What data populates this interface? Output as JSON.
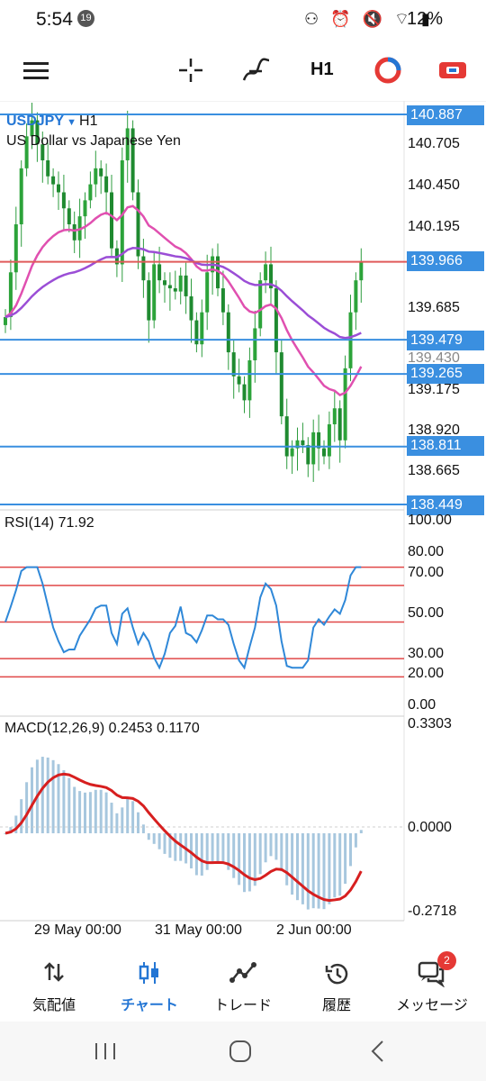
{
  "status_bar": {
    "time": "5:54",
    "notification_count": "19",
    "icons": "⚇ ⏰ 🔇 ⌔ ▮",
    "battery": "12%"
  },
  "toolbar": {
    "timeframe": "H1"
  },
  "chart": {
    "symbol": "USDJPY",
    "timeframe": "H1",
    "description": "US Dollar vs Japanese Yen",
    "price_axis": [
      "140.705",
      "140.450",
      "140.195",
      "139.685",
      "139.175",
      "138.920",
      "138.665"
    ],
    "hidden_axis": [
      "139.430"
    ],
    "hlines": [
      "140.887",
      "139.966",
      "139.479",
      "139.265",
      "138.811",
      "138.449"
    ],
    "rsi": {
      "title": "RSI(14) 71.92",
      "levels": [
        "100.00",
        "80.00",
        "70.00",
        "50.00",
        "30.00",
        "20.00",
        "0.00"
      ]
    },
    "macd": {
      "title": "MACD(12,26,9) 0.2453 0.1170",
      "levels": [
        "0.3303",
        "0.0000",
        "-0.2718"
      ]
    },
    "time_axis": [
      "29 May 00:00",
      "31 May 00:00",
      "2 Jun 00:00"
    ]
  },
  "bottom_nav": [
    {
      "label": "気配値",
      "icon": "sort-arrows-icon"
    },
    {
      "label": "チャート",
      "icon": "candles-icon"
    },
    {
      "label": "トレード",
      "icon": "trend-icon"
    },
    {
      "label": "履歴",
      "icon": "history-icon"
    },
    {
      "label": "メッセージ",
      "icon": "chat-icon",
      "badge": "2"
    }
  ],
  "chart_data": {
    "type": "candlestick",
    "symbol": "USDJPY",
    "timeframe": "H1",
    "x_labels": [
      "29 May 00:00",
      "31 May 00:00",
      "2 Jun 00:00"
    ],
    "ylim": [
      138.449,
      140.887
    ],
    "horizontal_levels": [
      140.887,
      139.966,
      139.479,
      139.265,
      138.811,
      138.449
    ],
    "closes": [
      139.62,
      139.9,
      140.2,
      140.55,
      140.75,
      140.85,
      140.7,
      140.6,
      140.5,
      140.45,
      140.4,
      140.3,
      140.2,
      140.1,
      140.25,
      140.35,
      140.45,
      140.55,
      140.5,
      140.4,
      140.05,
      139.95,
      140.6,
      140.8,
      140.4,
      140.0,
      139.85,
      139.6,
      139.95,
      139.85,
      139.82,
      139.8,
      139.78,
      139.88,
      139.75,
      139.6,
      139.45,
      139.65,
      139.9,
      140.0,
      139.8,
      139.65,
      139.4,
      139.25,
      139.2,
      139.1,
      139.35,
      139.55,
      139.85,
      139.95,
      139.8,
      139.4,
      139.0,
      138.75,
      138.8,
      138.85,
      138.82,
      138.7,
      138.9,
      138.8,
      138.75,
      138.95,
      139.05,
      138.85,
      139.3,
      139.65,
      139.85,
      139.97
    ],
    "rsi": {
      "ylim": [
        0,
        100
      ],
      "levels": [
        80,
        70,
        50,
        30,
        20
      ],
      "value": 71.92
    },
    "macd": {
      "ylim": [
        -0.2718,
        0.3303
      ],
      "macd": 0.2453,
      "signal": 0.117
    }
  }
}
